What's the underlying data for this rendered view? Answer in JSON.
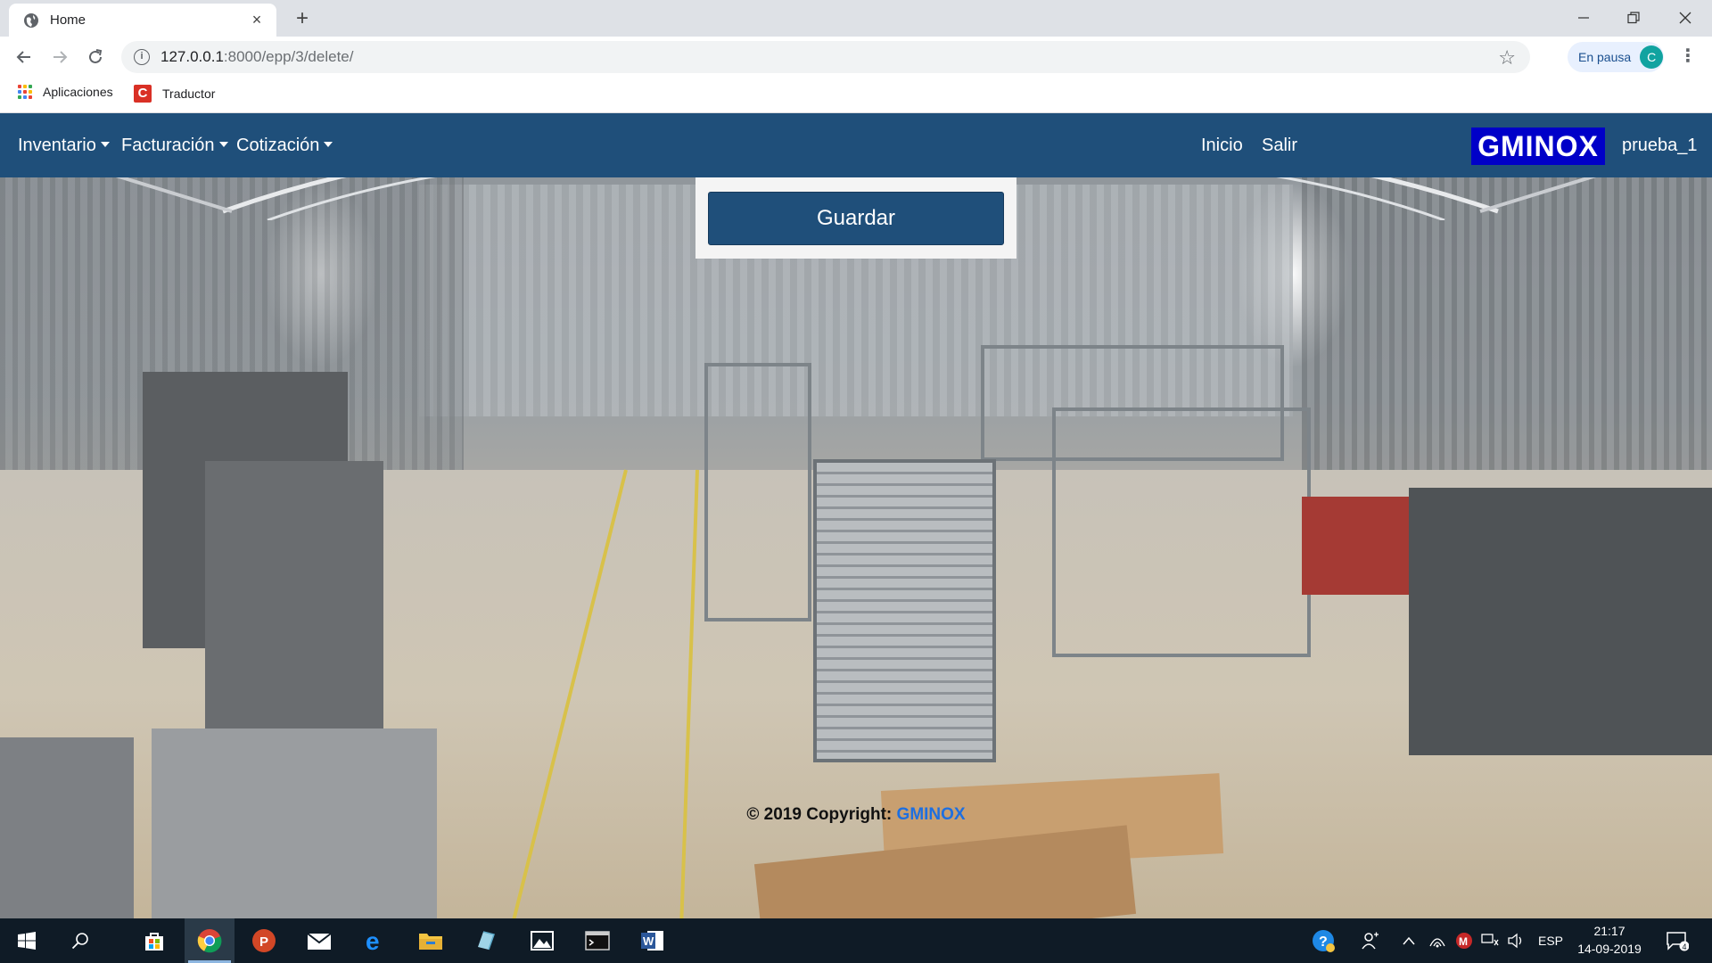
{
  "browser": {
    "tab_title": "Home",
    "tab_close": "×",
    "new_tab": "+",
    "url_host": "127.0.0.1",
    "url_path": ":8000/epp/3/delete/",
    "pause_label": "En pausa",
    "profile_initial": "C",
    "bookmarks": [
      {
        "label": "Aplicaciones"
      },
      {
        "label": "Traductor",
        "icon_letter": "C"
      }
    ]
  },
  "navbar": {
    "menus": [
      {
        "label": "Inventario"
      },
      {
        "label": "Facturación"
      },
      {
        "label": "Cotización"
      }
    ],
    "links": [
      {
        "label": "Inicio"
      },
      {
        "label": "Salir"
      }
    ],
    "brand": "GMINOX",
    "username": "prueba_1",
    "color": "#1f4f7a"
  },
  "form": {
    "save_label": "Guardar"
  },
  "footer": {
    "copyright": "© 2019 Copyright: ",
    "brand": "GMINOX"
  },
  "taskbar": {
    "apps": [
      "windows-start",
      "search",
      "store",
      "chrome",
      "powerpoint",
      "mail",
      "edge",
      "file-explorer",
      "app",
      "photos",
      "terminal",
      "word"
    ],
    "language": "ESP",
    "time": "21:17",
    "date": "14-09-2019",
    "notification_count": "4"
  }
}
